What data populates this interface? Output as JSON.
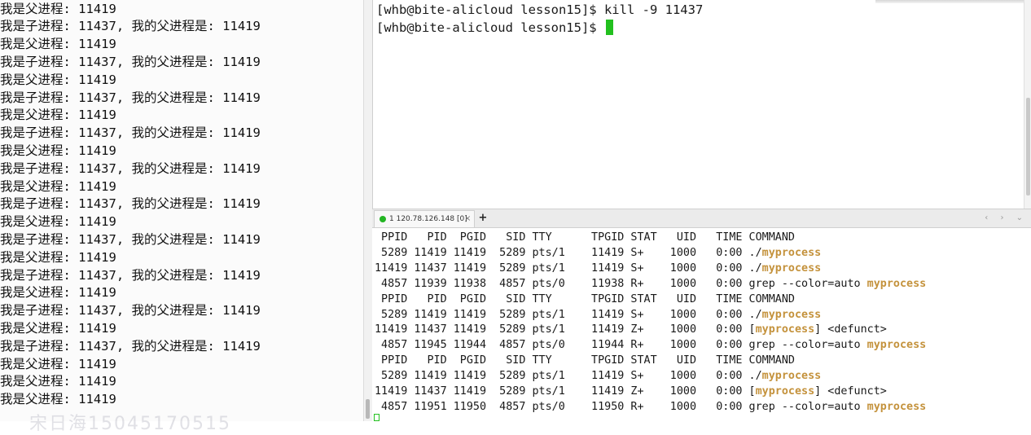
{
  "left_terminal": {
    "lines": [
      "我是父进程: 11419",
      "我是子进程: 11437, 我的父进程是: 11419",
      "我是父进程: 11419",
      "我是子进程: 11437, 我的父进程是: 11419",
      "我是父进程: 11419",
      "我是子进程: 11437, 我的父进程是: 11419",
      "我是父进程: 11419",
      "我是子进程: 11437, 我的父进程是: 11419",
      "我是父进程: 11419",
      "我是子进程: 11437, 我的父进程是: 11419",
      "我是父进程: 11419",
      "我是子进程: 11437, 我的父进程是: 11419",
      "我是父进程: 11419",
      "我是子进程: 11437, 我的父进程是: 11419",
      "我是父进程: 11419",
      "我是子进程: 11437, 我的父进程是: 11419",
      "我是父进程: 11419",
      "我是子进程: 11437, 我的父进程是: 11419",
      "我是父进程: 11419",
      "我是子进程: 11437, 我的父进程是: 11419",
      "我是父进程: 11419",
      "我是父进程: 11419",
      "我是父进程: 11419"
    ],
    "watermark": "宋日海15045170515"
  },
  "top_terminal": {
    "prompt": "[whb@bite-alicloud lesson15]$ ",
    "command": "kill -9 11437"
  },
  "tab": {
    "label": "1 120.78.126.148 [0]",
    "close": "×",
    "add": "+",
    "nav": "‹ › ⌄",
    "status_color": "#23b523"
  },
  "bottom_terminal": {
    "highlight_word": "myprocess",
    "highlight_color": "#c4923c",
    "lines": [
      {
        "pre": " PPID   PID  PGID   SID TTY      TPGID STAT   UID   TIME COMMAND",
        "hl": "",
        "post": ""
      },
      {
        "pre": " 5289 11419 11419  5289 pts/1    11419 S+    1000   0:00 ./",
        "hl": "myprocess",
        "post": ""
      },
      {
        "pre": "11419 11437 11419  5289 pts/1    11419 S+    1000   0:00 ./",
        "hl": "myprocess",
        "post": ""
      },
      {
        "pre": " 4857 11939 11938  4857 pts/0    11938 R+    1000   0:00 grep --color=auto ",
        "hl": "myprocess",
        "post": ""
      },
      {
        "pre": " PPID   PID  PGID   SID TTY      TPGID STAT   UID   TIME COMMAND",
        "hl": "",
        "post": ""
      },
      {
        "pre": " 5289 11419 11419  5289 pts/1    11419 S+    1000   0:00 ./",
        "hl": "myprocess",
        "post": ""
      },
      {
        "pre": "11419 11437 11419  5289 pts/1    11419 Z+    1000   0:00 [",
        "hl": "myprocess",
        "post": "] <defunct>"
      },
      {
        "pre": " 4857 11945 11944  4857 pts/0    11944 R+    1000   0:00 grep --color=auto ",
        "hl": "myprocess",
        "post": ""
      },
      {
        "pre": " PPID   PID  PGID   SID TTY      TPGID STAT   UID   TIME COMMAND",
        "hl": "",
        "post": ""
      },
      {
        "pre": " 5289 11419 11419  5289 pts/1    11419 S+    1000   0:00 ./",
        "hl": "myprocess",
        "post": ""
      },
      {
        "pre": "11419 11437 11419  5289 pts/1    11419 Z+    1000   0:00 [",
        "hl": "myprocess",
        "post": "] <defunct>"
      },
      {
        "pre": " 4857 11951 11950  4857 pts/0    11950 R+    1000   0:00 grep --color=auto ",
        "hl": "myprocess",
        "post": ""
      }
    ]
  }
}
